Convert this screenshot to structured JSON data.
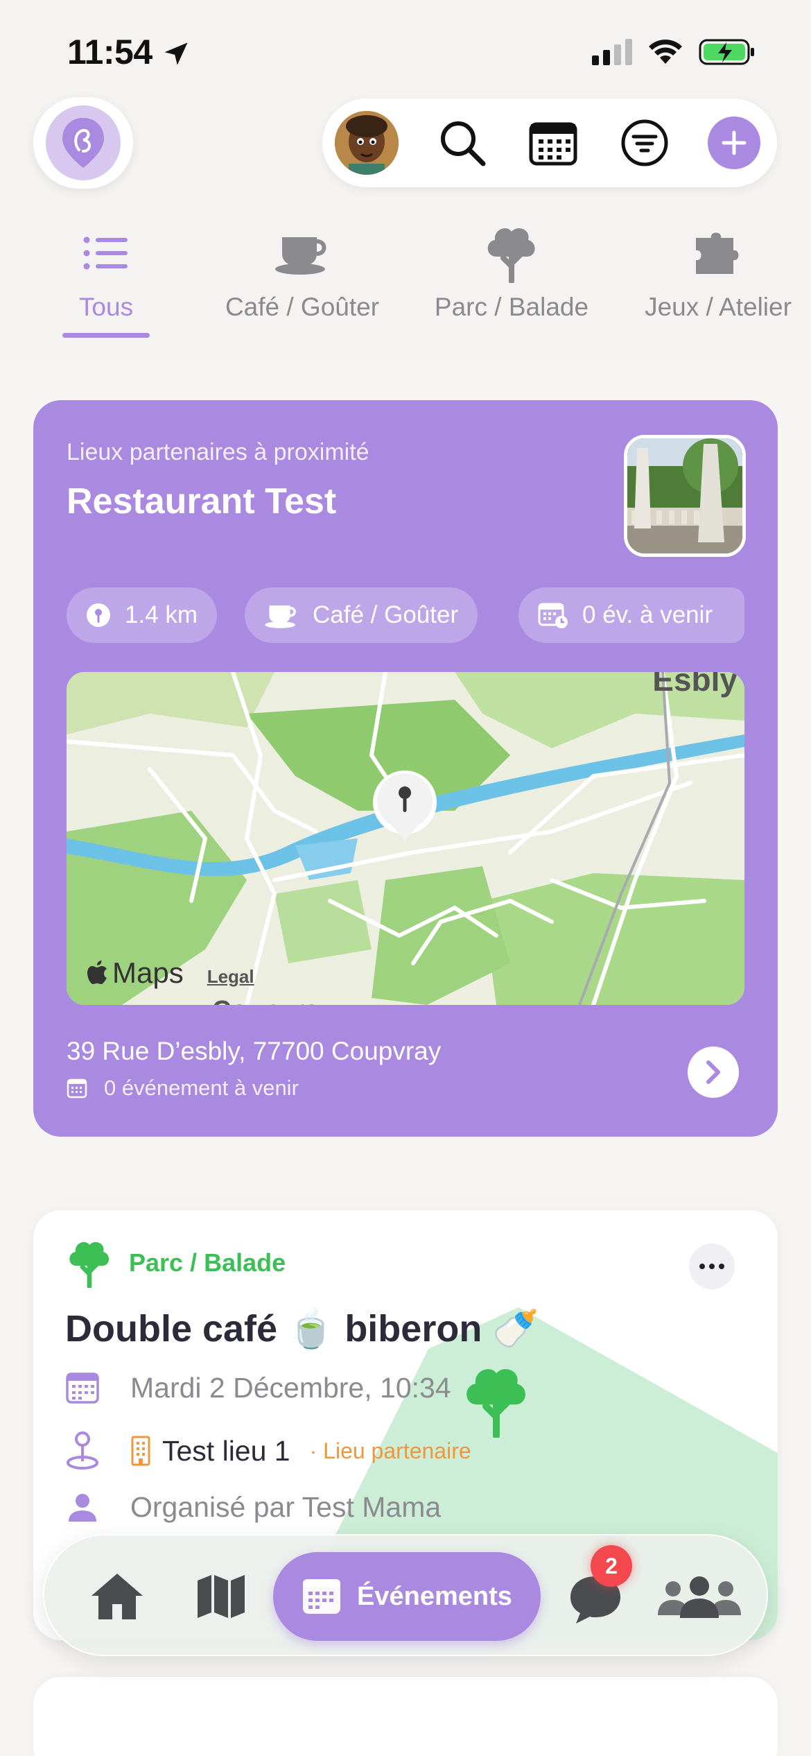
{
  "status_bar": {
    "time": "11:54"
  },
  "categories": [
    {
      "label": "Tous",
      "icon": "list-icon",
      "active": true
    },
    {
      "label": "Café / Goûter",
      "icon": "coffee-cup-icon",
      "active": false
    },
    {
      "label": "Parc / Balade",
      "icon": "tree-icon",
      "active": false
    },
    {
      "label": "Jeux / Atelier",
      "icon": "puzzle-icon",
      "active": false
    }
  ],
  "partner": {
    "subtitle": "Lieux partenaires à proximité",
    "name": "Restaurant Test",
    "chips": {
      "distance": "1.4 km",
      "category": "Café / Goûter",
      "upcoming": "0 év. à venir"
    },
    "map": {
      "place_top": "Esbly",
      "place_bottom": "Coupvray",
      "brand": "Maps",
      "legal": "Legal"
    },
    "address": "39 Rue D’esbly, 77700 Coupvray",
    "events": "0 événement à venir"
  },
  "event": {
    "category": "Parc / Balade",
    "title": "Double café 🍵 biberon 🍼",
    "date": "Mardi 2 Décembre, 10:34",
    "place": "Test lieu 1",
    "place_partner": "· Lieu partenaire",
    "organizer": "Organisé par Test Mama"
  },
  "nav": {
    "events_label": "Événements",
    "chat_badge": "2"
  },
  "colors": {
    "accent": "#a98ae0",
    "park_green": "#3cbf55",
    "partner_orange": "#f0963c",
    "badge_red": "#f2484e"
  }
}
